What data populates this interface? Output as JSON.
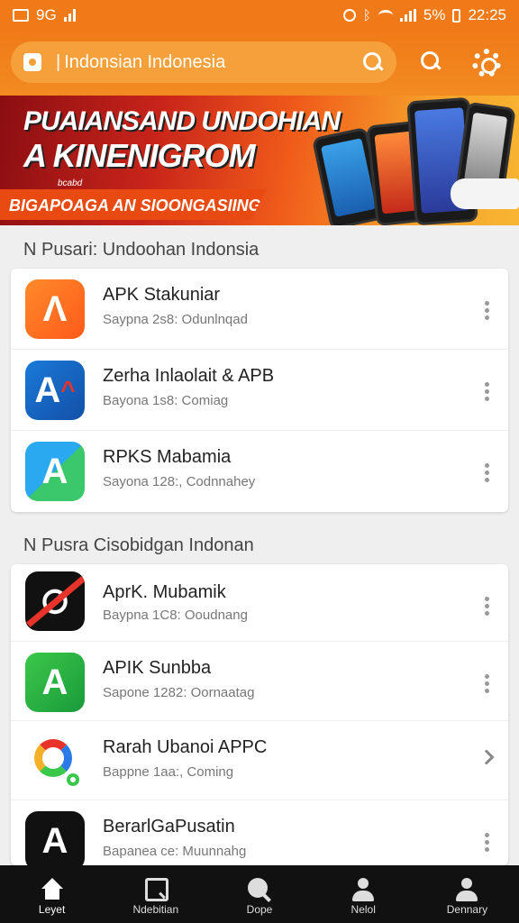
{
  "status_bar": {
    "left_text": "9G",
    "battery": "5%",
    "time": "22:25"
  },
  "search": {
    "text": "Indonsian  Indonesia"
  },
  "banner": {
    "line1": "PUAIANSAND UNDOHIAN",
    "line2": "A KINENIGROM",
    "tiny": "bcabd",
    "strip": "BIGAPOAGA AN SIOONGASIING"
  },
  "sections": [
    {
      "title": "N Pusari: Undoohan Indonsia",
      "apps": [
        {
          "name": "APK Stakuniar",
          "sub": "Saypna 2s8: Odunlnqad",
          "icon": "orange-ya-icon",
          "action": "kebab"
        },
        {
          "name": "Zerha Inlaolait & APB",
          "sub": "Bayona 1s8: Comiag",
          "icon": "blue-red-a-icon",
          "action": "kebab"
        },
        {
          "name": "RPKS Mabamia",
          "sub": "Sayona 128:, Codnnahey",
          "icon": "blue-green-a-icon",
          "action": "kebab"
        }
      ]
    },
    {
      "title": "N Pusra Cisobidgan Indonan",
      "apps": [
        {
          "name": "AprK. Mubamik",
          "sub": "Baypna 1C8: Ooudnang",
          "icon": "black-red-slash-icon",
          "action": "kebab"
        },
        {
          "name": "APIK Sunbba",
          "sub": "Sapone 1282: Oornaatag",
          "icon": "green-a-icon",
          "action": "kebab"
        },
        {
          "name": "Rarah Ubanoi APPC",
          "sub": "Bappne 1aa:, Coming",
          "icon": "colorful-pin-icon",
          "action": "chevron"
        },
        {
          "name": "BerarlGaPusatin",
          "sub": "Bapanea ce: Muunnahg",
          "icon": "black-a-icon",
          "action": "kebab"
        }
      ]
    }
  ],
  "bottom_nav": [
    {
      "label": "Leyet",
      "icon": "home-icon"
    },
    {
      "label": "Ndebitian",
      "icon": "search-square-icon"
    },
    {
      "label": "Dope",
      "icon": "magnifier-icon"
    },
    {
      "label": "Nelol",
      "icon": "profile-icon"
    },
    {
      "label": "Dennary",
      "icon": "person-icon"
    }
  ]
}
